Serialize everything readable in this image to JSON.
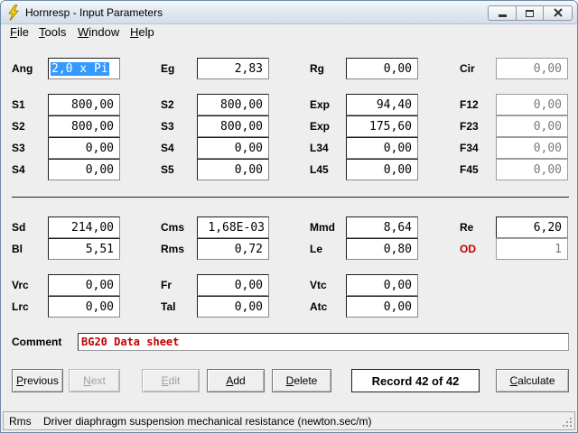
{
  "window": {
    "title": "Hornresp - Input Parameters"
  },
  "menu": [
    {
      "accel": "F",
      "rest": "ile"
    },
    {
      "accel": "T",
      "rest": "ools"
    },
    {
      "accel": "W",
      "rest": "indow"
    },
    {
      "accel": "H",
      "rest": "elp"
    }
  ],
  "params": {
    "ang": {
      "label": "Ang",
      "value": "2,0 x Pi"
    },
    "eg": {
      "label": "Eg",
      "value": "2,83"
    },
    "rg": {
      "label": "Rg",
      "value": "0,00"
    },
    "cir": {
      "label": "Cir",
      "value": "0,00"
    },
    "s1": {
      "label": "S1",
      "value": "800,00"
    },
    "s2a": {
      "label": "S2",
      "value": "800,00"
    },
    "s3a": {
      "label": "S3",
      "value": "0,00"
    },
    "s4a": {
      "label": "S4",
      "value": "0,00"
    },
    "s2b": {
      "label": "S2",
      "value": "800,00"
    },
    "s3b": {
      "label": "S3",
      "value": "800,00"
    },
    "s4b": {
      "label": "S4",
      "value": "0,00"
    },
    "s5": {
      "label": "S5",
      "value": "0,00"
    },
    "exp1": {
      "label": "Exp",
      "value": "94,40"
    },
    "exp2": {
      "label": "Exp",
      "value": "175,60"
    },
    "l34": {
      "label": "L34",
      "value": "0,00"
    },
    "l45": {
      "label": "L45",
      "value": "0,00"
    },
    "f12": {
      "label": "F12",
      "value": "0,00"
    },
    "f23": {
      "label": "F23",
      "value": "0,00"
    },
    "f34": {
      "label": "F34",
      "value": "0,00"
    },
    "f45": {
      "label": "F45",
      "value": "0,00"
    },
    "sd": {
      "label": "Sd",
      "value": "214,00"
    },
    "bl": {
      "label": "Bl",
      "value": "5,51"
    },
    "cms": {
      "label": "Cms",
      "value": "1,68E-03"
    },
    "rms": {
      "label": "Rms",
      "value": "0,72"
    },
    "mmd": {
      "label": "Mmd",
      "value": "8,64"
    },
    "le": {
      "label": "Le",
      "value": "0,80"
    },
    "re": {
      "label": "Re",
      "value": "6,20"
    },
    "od": {
      "label": "OD",
      "value": "1"
    },
    "vrc": {
      "label": "Vrc",
      "value": "0,00"
    },
    "lrc": {
      "label": "Lrc",
      "value": "0,00"
    },
    "fr": {
      "label": "Fr",
      "value": "0,00"
    },
    "tal": {
      "label": "Tal",
      "value": "0,00"
    },
    "vtc": {
      "label": "Vtc",
      "value": "0,00"
    },
    "atc": {
      "label": "Atc",
      "value": "0,00"
    }
  },
  "comment": {
    "label": "Comment",
    "value": "BG20 Data sheet"
  },
  "buttons": {
    "previous": {
      "accel": "P",
      "rest": "revious"
    },
    "next": {
      "accel": "N",
      "rest": "ext"
    },
    "edit": {
      "accel": "E",
      "rest": "dit"
    },
    "add": {
      "accel": "A",
      "rest": "dd"
    },
    "delete": {
      "accel": "D",
      "rest": "elete"
    },
    "calculate": {
      "accel": "C",
      "rest": "alculate"
    }
  },
  "record": "Record 42 of 42",
  "status": {
    "field": "Rms",
    "description": "Driver diaphragm suspension mechanical resistance  (newton.sec/m)"
  }
}
